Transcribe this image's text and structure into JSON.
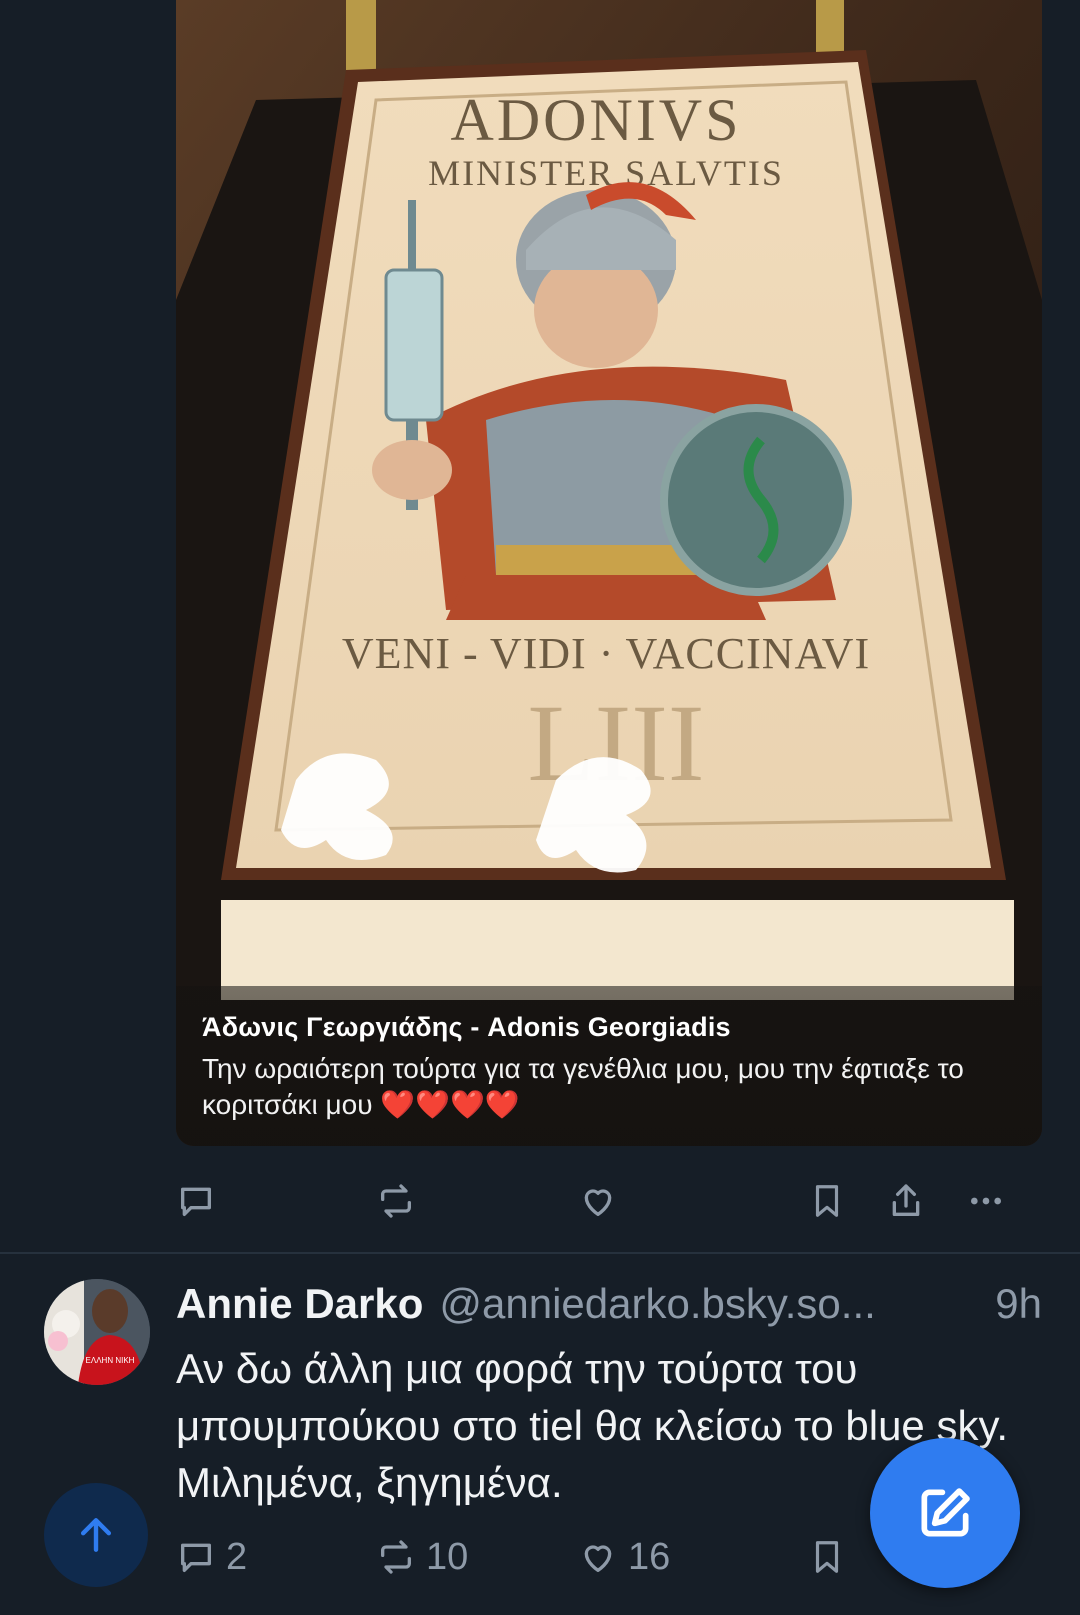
{
  "embed": {
    "cake": {
      "title": "ADONIVS",
      "subtitle": "MINISTER SALVTIS",
      "motto": "VENI - VIDI · VACCINAVI",
      "numeral": "LIII"
    },
    "caption_author": "Άδωνις Γεωργιάδης - Adonis Georgiadis",
    "caption_text": "Την ωραιότερη τούρτα για τα γενέθλια μου, μου την έφτιαξε το κοριτσάκι μου",
    "caption_hearts": "❤️❤️❤️❤️"
  },
  "top_actions": {
    "reply_count": "",
    "repost_count": "",
    "like_count": ""
  },
  "post": {
    "display_name": "Annie Darko",
    "handle": "@anniedarko.bsky.so...",
    "time": "9h",
    "text": "Αν δω άλλη μια φορά την τούρτα του μπουμπούκου στο tiel θα κλείσω το blue sky. Μιλημένα, ξηγημένα.",
    "avatar_shirt_text": "ΕΛΛΗΝ ΝΙΚΗ",
    "reply_count": "2",
    "repost_count": "10",
    "like_count": "16"
  },
  "icons": {
    "reply": "reply-icon",
    "repost": "repost-icon",
    "like": "heart-icon",
    "bookmark": "bookmark-icon",
    "share": "share-icon",
    "more": "more-icon",
    "scroll_top": "arrow-up-icon",
    "compose": "compose-icon"
  },
  "colors": {
    "background": "#161e27",
    "muted": "#8e9aa8",
    "accent": "#2f7cf0"
  }
}
